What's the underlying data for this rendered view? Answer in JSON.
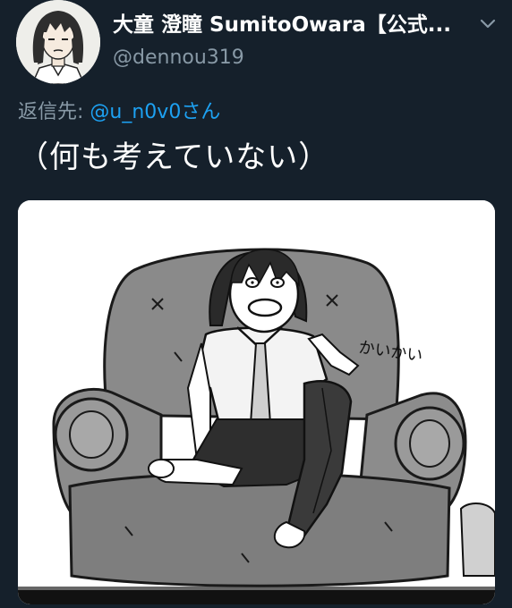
{
  "tweet": {
    "display_name": "大童 澄瞳 SumitoOwara【公式...",
    "handle": "@dennou319",
    "reply_prefix": "返信先:",
    "reply_mention": "@u_n0v0さん",
    "text": "（何も考えていない）"
  },
  "media": {
    "sfx_text": "かいかい"
  },
  "colors": {
    "background": "#15202b",
    "secondary_text": "#8899a6",
    "link": "#1da1f2"
  },
  "icons": {
    "caret": "chevron-down-icon"
  }
}
